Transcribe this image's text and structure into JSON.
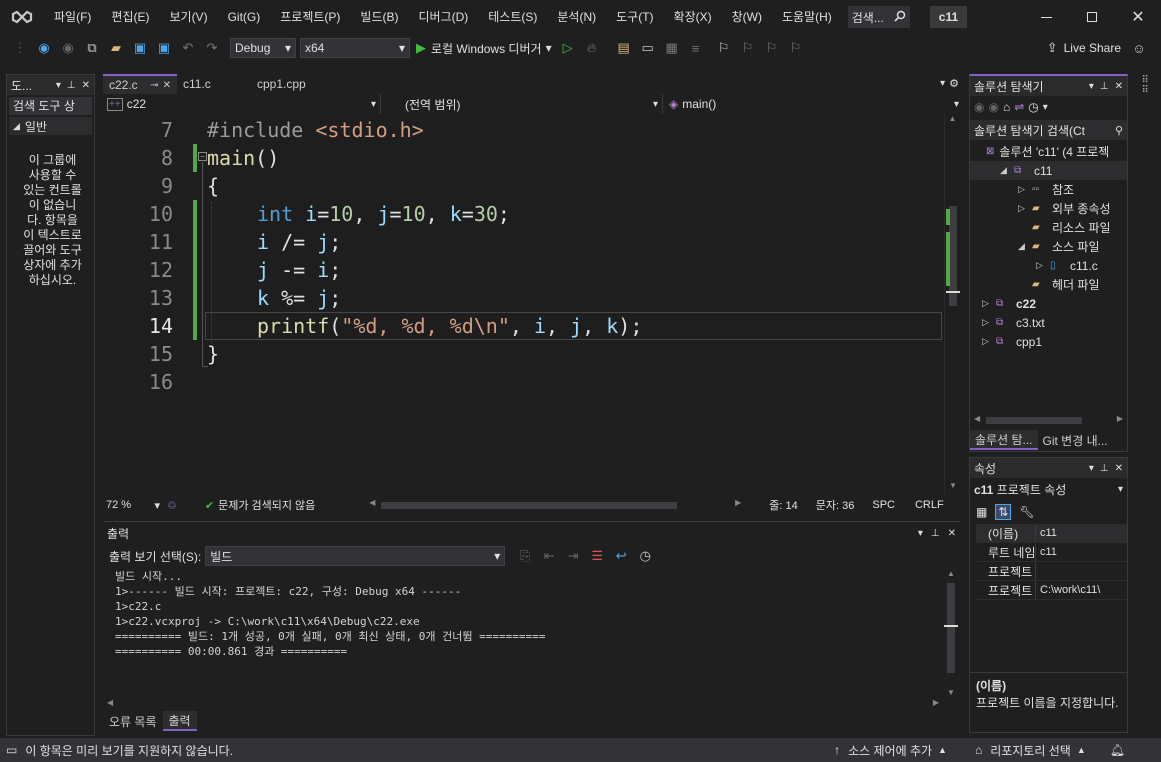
{
  "menu": [
    "파일(F)",
    "편집(E)",
    "보기(V)",
    "Git(G)",
    "프로젝트(P)",
    "빌드(B)",
    "디버그(D)",
    "테스트(S)",
    "분석(N)",
    "도구(T)",
    "확장(X)",
    "창(W)",
    "도움말(H)"
  ],
  "search_label": "검색...",
  "window_title": "c11",
  "toolbar": {
    "config": "Debug",
    "platform": "x64",
    "run_label": "로컬 Windows 디버거",
    "live_share": "Live Share"
  },
  "toolbox": {
    "title": "도...",
    "search": "검색 도구 상",
    "section": "일반",
    "empty_text": "이 그룹에 사용할 수 있는 컨트롤이 없습니다. 항목을 이 텍스트로 끌어와 도구 상자에 추가하십시오."
  },
  "editor": {
    "tabs": [
      "c22.c",
      "c11.c",
      "cpp1.cpp"
    ],
    "nav": {
      "project": "c22",
      "scope": "(전역 범위)",
      "member": "main()"
    },
    "line_numbers": [
      "7",
      "8",
      "9",
      "10",
      "11",
      "12",
      "13",
      "14",
      "15",
      "16"
    ],
    "lines": {
      "l7a": "#include ",
      "l7b": "<stdio.h>",
      "l8a": "main",
      "l8b": "()",
      "l9": "{",
      "l10a": "int",
      "l10b": " i",
      "l10c": "=",
      "l10d": "10",
      "l10e": ", ",
      "l10f": "j",
      "l10g": "=",
      "l10h": "10",
      "l10i": ", ",
      "l10j": "k",
      "l10k": "=",
      "l10l": "30",
      "l10m": ";",
      "l11a": "i",
      "l11b": " /= ",
      "l11c": "j",
      "l11d": ";",
      "l12a": "j",
      "l12b": " -= ",
      "l12c": "i",
      "l12d": ";",
      "l13a": "k",
      "l13b": " %= ",
      "l13c": "j",
      "l13d": ";",
      "l14a": "printf",
      "l14b": "(",
      "l14c": "\"%d, %d, %d\\n\"",
      "l14d": ", ",
      "l14e": "i",
      "l14f": ", ",
      "l14g": "j",
      "l14h": ", ",
      "l14i": "k",
      "l14j": ");",
      "l15": "}"
    },
    "status": {
      "zoom": "72 %",
      "issues": "문제가 검색되지 않음",
      "line": "줄: 14",
      "col": "문자: 36",
      "spc": "SPC",
      "crlf": "CRLF"
    }
  },
  "output": {
    "title": "출력",
    "source_label": "출력 보기 선택(S):",
    "source_value": "빌드",
    "lines": [
      "빌드 시작...",
      "1>------ 빌드 시작: 프로젝트: c22, 구성: Debug x64 ------",
      "1>c22.c",
      "1>c22.vcxproj -> C:\\work\\c11\\x64\\Debug\\c22.exe",
      "========== 빌드: 1개 성공, 0개 실패, 0개 최신 상태, 0개 건너뜀 ==========",
      "========== 00:00.861 경과 =========="
    ],
    "tabs": [
      "오류 목록",
      "출력"
    ]
  },
  "solution": {
    "title": "솔루션 탐색기",
    "search": "솔루션 탐색기 검색(Ct",
    "root": "솔루션 'c11' (4 프로젝",
    "items": [
      {
        "label": "c11",
        "indent": 1,
        "exp": "◢",
        "icon": "cpp"
      },
      {
        "label": "참조",
        "indent": 2,
        "exp": "▷",
        "icon": "ref"
      },
      {
        "label": "외부 종속성",
        "indent": 2,
        "exp": "▷",
        "icon": "folder"
      },
      {
        "label": "리소스 파일",
        "indent": 2,
        "exp": "",
        "icon": "folder"
      },
      {
        "label": "소스 파일",
        "indent": 2,
        "exp": "◢",
        "icon": "folder"
      },
      {
        "label": "c11.c",
        "indent": 3,
        "exp": "▷",
        "icon": "file"
      },
      {
        "label": "헤더 파일",
        "indent": 2,
        "exp": "",
        "icon": "folder"
      },
      {
        "label": "c22",
        "indent": 0,
        "exp": "▷",
        "icon": "cpp",
        "bold": true
      },
      {
        "label": "c3.txt",
        "indent": 0,
        "exp": "▷",
        "icon": "cpp"
      },
      {
        "label": "cpp1",
        "indent": 0,
        "exp": "▷",
        "icon": "cpp"
      }
    ],
    "bottom_tabs": [
      "솔루션 탐...",
      "Git 변경 내..."
    ]
  },
  "properties": {
    "title": "속성",
    "object": "c11",
    "object_type": "프로젝트 속성",
    "rows": [
      {
        "name": "(이름)",
        "value": "c11"
      },
      {
        "name": "루트 네임스",
        "value": "c11"
      },
      {
        "name": "프로젝트 종",
        "value": ""
      },
      {
        "name": "프로젝트 파",
        "value": "C:\\work\\c11\\"
      }
    ],
    "desc_title": "(이름)",
    "desc_text": "프로젝트 이름을 지정합니다."
  },
  "statusbar": {
    "message": "이 항목은 미리 보기를 지원하지 않습니다.",
    "source_control": "소스 제어에 추가",
    "repo": "리포지토리 선택"
  },
  "colors": {
    "bg": "#1f1f1f",
    "editor_bg": "#1e1e1e",
    "accent": "#8661c5",
    "keyword": "#569cd6",
    "string": "#d69d85",
    "variable": "#9cdcfe",
    "number": "#b5cea8",
    "function": "#dcdcaa"
  }
}
